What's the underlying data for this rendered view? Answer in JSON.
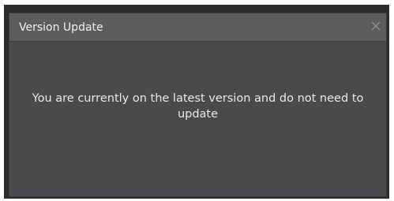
{
  "dialog": {
    "title": "Version Update",
    "message": "You are currently on the latest version and do not need to update",
    "close_icon": "close-icon"
  },
  "colors": {
    "outer_frame": "#2b2b2b",
    "dialog_background": "#4a4a4c",
    "titlebar_background": "#5d5d60",
    "text": "#e9e9e9"
  }
}
